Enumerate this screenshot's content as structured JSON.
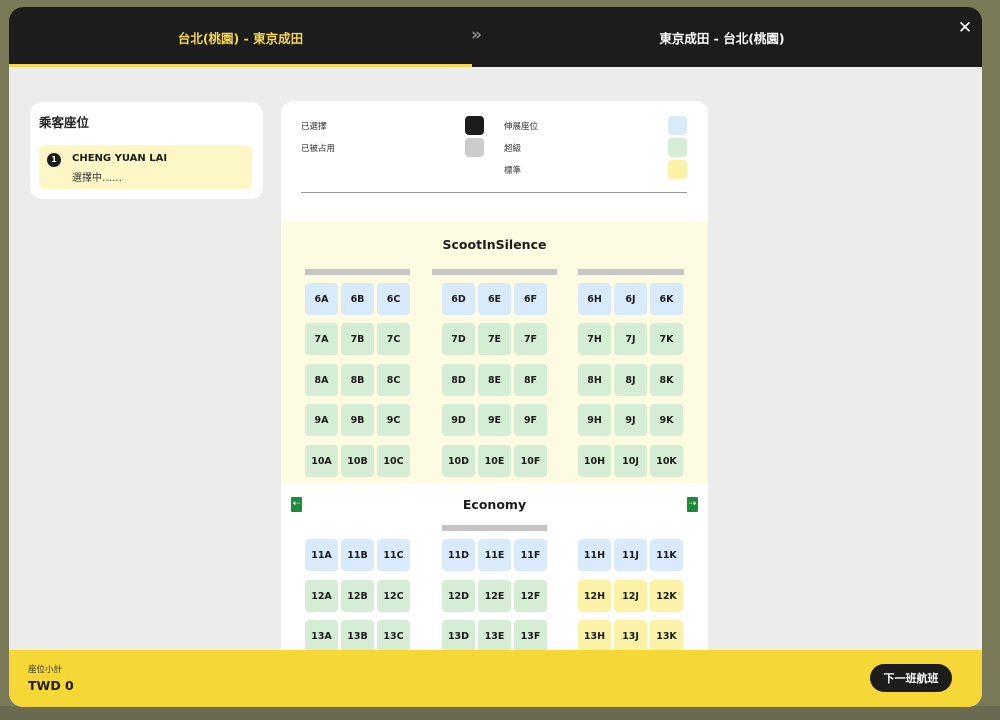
{
  "header": {
    "tabs": [
      {
        "label": "台北(桃園) - 東京成田",
        "active": true
      },
      {
        "label": "東京成田 - 台北(桃園)",
        "active": false
      }
    ],
    "separator": "»",
    "close": "✕"
  },
  "passenger_panel": {
    "title": "乘客座位",
    "passengers": [
      {
        "number": "1",
        "name": "CHENG YUAN LAI",
        "status": "選擇中……"
      }
    ]
  },
  "legend": {
    "selected": "已選擇",
    "occupied": "已被占用",
    "stretch": "伸展座位",
    "super": "超級",
    "standard": "標準"
  },
  "colors": {
    "accent": "#f5d94a",
    "selected": "#1c1c1c",
    "occupied": "#cccccc",
    "stretch": "#d9eafb",
    "super": "#d5ecd5",
    "standard": "#fbf2a7"
  },
  "cabins": {
    "silence": "ScootInSilence",
    "economy": "Economy"
  },
  "seat_rows": [
    {
      "row": "6",
      "type": "stretch",
      "seats": [
        "6A",
        "6B",
        "6C",
        "6D",
        "6E",
        "6F",
        "6H",
        "6J",
        "6K"
      ]
    },
    {
      "row": "7",
      "type": "super",
      "seats": [
        "7A",
        "7B",
        "7C",
        "7D",
        "7E",
        "7F",
        "7H",
        "7J",
        "7K"
      ]
    },
    {
      "row": "8",
      "type": "super",
      "seats": [
        "8A",
        "8B",
        "8C",
        "8D",
        "8E",
        "8F",
        "8H",
        "8J",
        "8K"
      ]
    },
    {
      "row": "9",
      "type": "super",
      "seats": [
        "9A",
        "9B",
        "9C",
        "9D",
        "9E",
        "9F",
        "9H",
        "9J",
        "9K"
      ]
    },
    {
      "row": "10",
      "type": "super",
      "seats": [
        "10A",
        "10B",
        "10C",
        "10D",
        "10E",
        "10F",
        "10H",
        "10J",
        "10K"
      ]
    },
    {
      "row": "11",
      "type": "stretch",
      "seats": [
        "11A",
        "11B",
        "11C",
        "11D",
        "11E",
        "11F",
        "11H",
        "11J",
        "11K"
      ]
    },
    {
      "row": "12",
      "types": [
        "super",
        "super",
        "super",
        "super",
        "super",
        "super",
        "standard",
        "standard",
        "standard"
      ],
      "seats": [
        "12A",
        "12B",
        "12C",
        "12D",
        "12E",
        "12F",
        "12H",
        "12J",
        "12K"
      ]
    },
    {
      "row": "13",
      "types": [
        "super",
        "super",
        "super",
        "super",
        "super",
        "super",
        "standard",
        "standard",
        "standard"
      ],
      "seats": [
        "13A",
        "13B",
        "13C",
        "13D",
        "13E",
        "13F",
        "13H",
        "13J",
        "13K"
      ]
    }
  ],
  "footer": {
    "subtotal_label": "座位小計",
    "subtotal_value": "TWD 0",
    "next_button": "下一班航班"
  }
}
